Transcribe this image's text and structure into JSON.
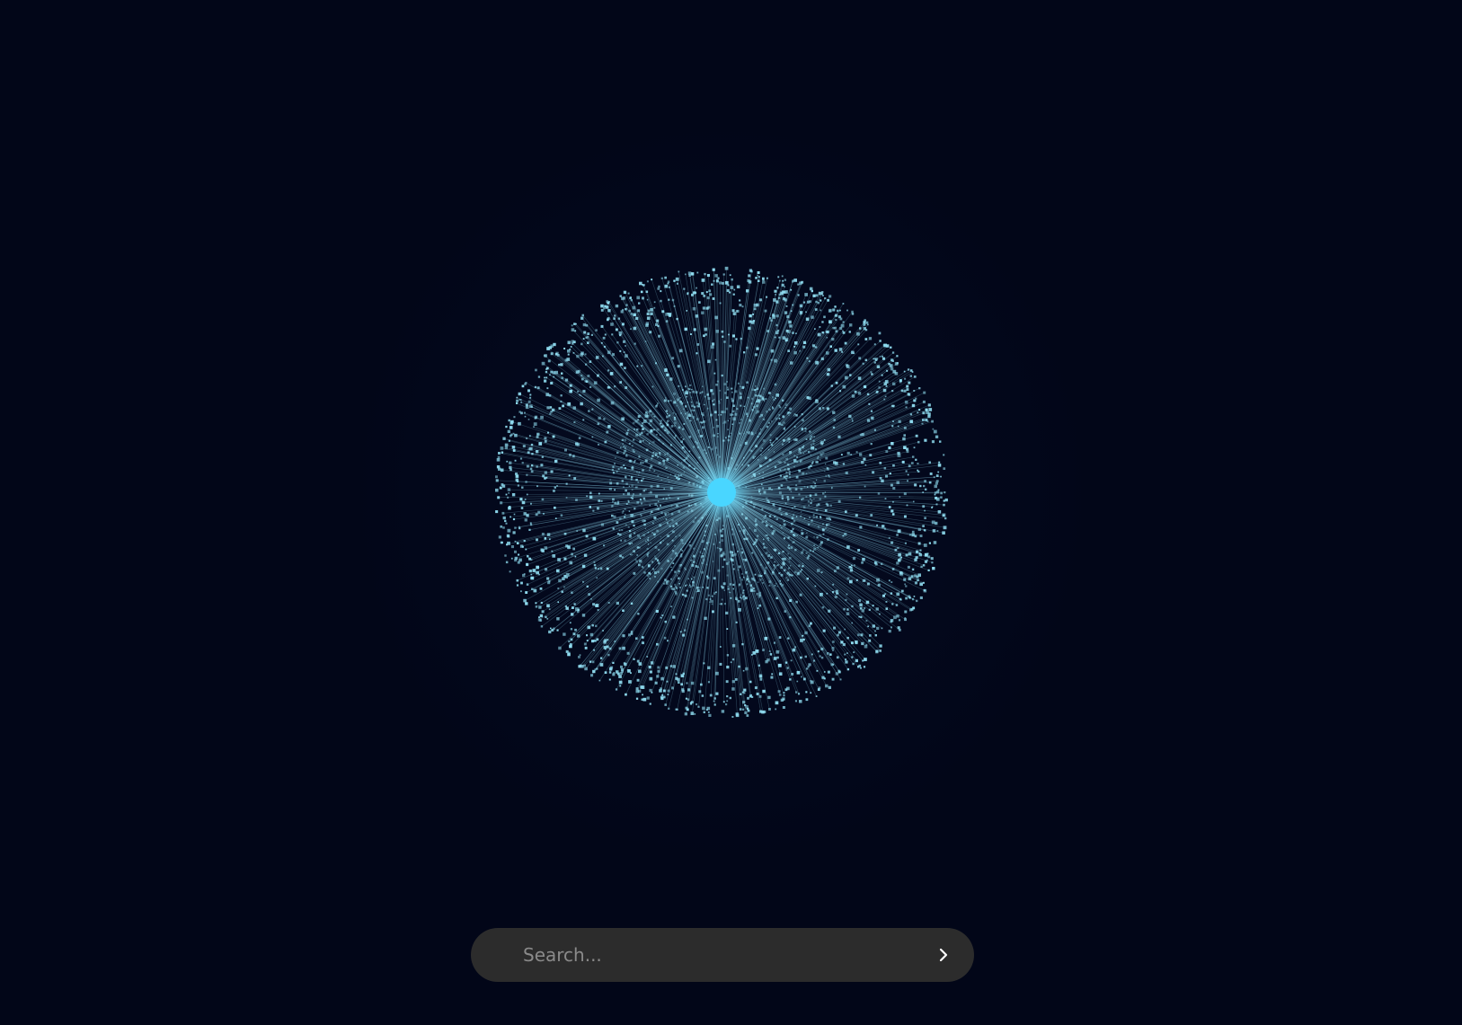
{
  "search": {
    "placeholder": "Search...",
    "value": ""
  },
  "submit": {
    "icon": "chevron-right-icon"
  },
  "colors": {
    "background": "#020618",
    "particle": "#8fdcf0",
    "core": "#49d6ff",
    "search_bar": "#2c2c2c",
    "placeholder_text": "#8a8a8a",
    "chevron": "#ffffff"
  }
}
